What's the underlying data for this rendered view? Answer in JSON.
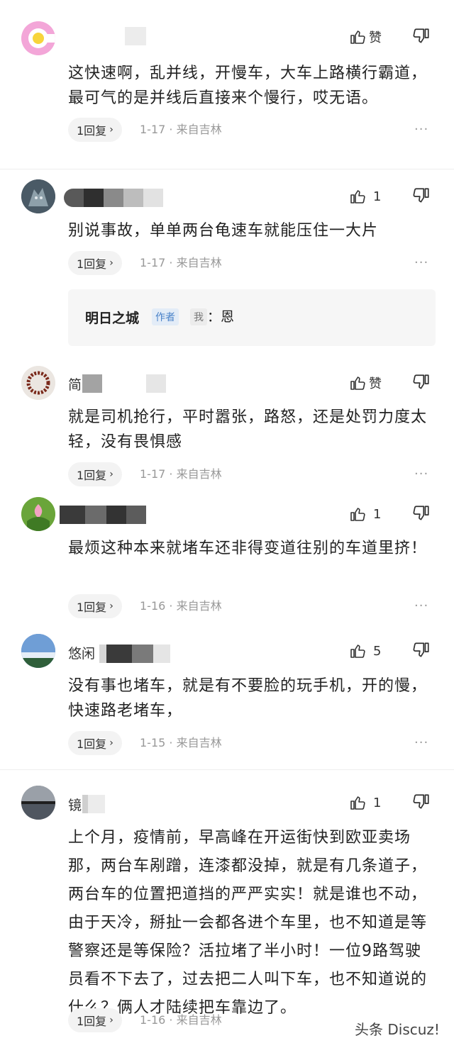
{
  "comments": [
    {
      "username": "",
      "likes": "赞",
      "text": "这快速啊，乱并线，开慢车，大车上路横行霸道，最可气的是并线后直接来个慢行，哎无语。",
      "reply_label": "1回复",
      "meta": "1-17 · 来自吉林",
      "more": "···"
    },
    {
      "username": "",
      "likes": "1",
      "text": "别说事故，单单两台龟速车就能压住一大片",
      "reply_label": "1回复",
      "meta": "1-17 · 来自吉林",
      "more": "···",
      "author_reply": {
        "name": "明日之城",
        "author_tag": "作者",
        "me_tag": "我",
        "text": "：恩"
      }
    },
    {
      "username": "简",
      "likes": "赞",
      "text": "就是司机抢行，平时嚣张，路怒，还是处罚力度太轻，没有畏惧感",
      "reply_label": "1回复",
      "meta": "1-17 · 来自吉林",
      "more": "···"
    },
    {
      "username": "",
      "likes": "1",
      "text": "最烦这种本来就堵车还非得变道往别的车道里挤！",
      "reply_label": "1回复",
      "meta": "1-16 · 来自吉林",
      "more": "···"
    },
    {
      "username": "悠闲",
      "likes": "5",
      "text": "没有事也堵车，就是有不要脸的玩手机，开的慢，快速路老堵车，",
      "reply_label": "1回复",
      "meta": "1-15 · 来自吉林",
      "more": "···"
    },
    {
      "username": "镜",
      "likes": "1",
      "text": "上个月，疫情前，早高峰在开运街快到欧亚卖场那，两台车剐蹭，连漆都没掉，就是有几条道子，两台车的位置把道挡的严严实实！就是谁也不动，由于天冷，掰扯一会都各进个车里，也不知道是等警察还是等保险？活拉堵了半小时！一位9路驾驶员看不下去了，过去把二人叫下车，也不知道说的什么？俩人才陆续把车靠边了。",
      "reply_label": "1回复",
      "meta": "1-16 · 来自吉林",
      "more": ""
    }
  ],
  "watermark": "头条 Discuz!",
  "icons": {
    "like": "thumbs-up-icon",
    "dislike": "thumbs-down-icon",
    "chevron": "chevron-right-icon"
  }
}
